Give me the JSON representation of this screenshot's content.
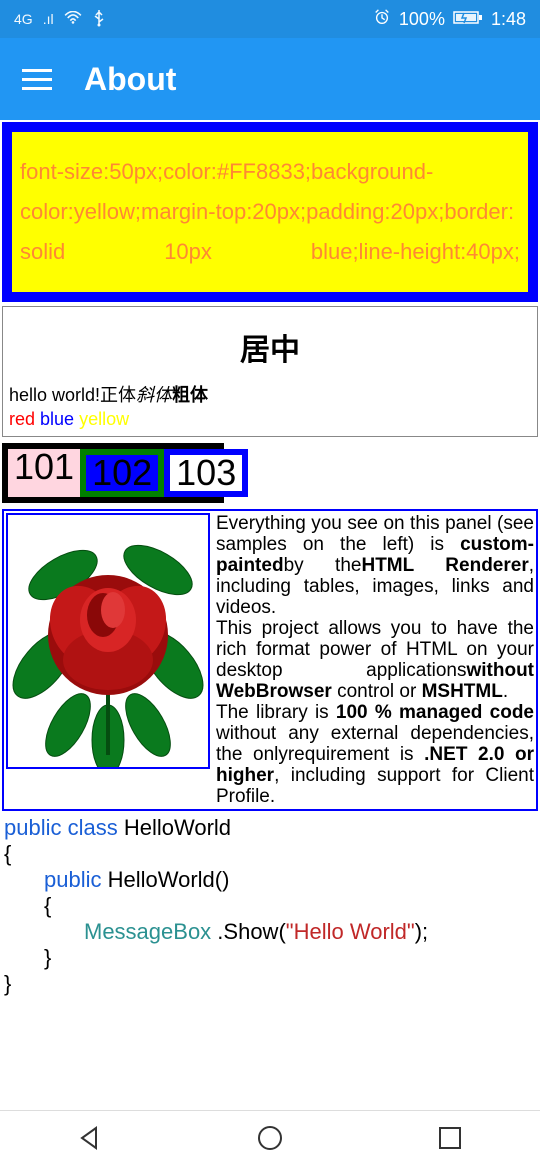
{
  "statusbar": {
    "signal": "4G",
    "battery_pct": "100%",
    "time": "1:48"
  },
  "appbar": {
    "title": "About"
  },
  "yellowbox_text": "font-size:50px;color:#FF8833;background-color:yellow;margin-top:20px;padding:20px;border: solid 10px blue;line-height:40px;",
  "graybox": {
    "centered": "居中",
    "hello_plain": "hello world!正体",
    "hello_italic": "斜体",
    "hello_bold": "粗体",
    "red": "red",
    "blue": "blue",
    "yellow": "yellow"
  },
  "numbers": {
    "a": "101",
    "b": "102",
    "c": "103"
  },
  "panel": {
    "p1a": "Everything you see on this panel (see samples on the left) is",
    "p1b": "custom-painted",
    "p1c": "by the",
    "p1d": "HTML Renderer",
    "p1e": ", including tables, images, links and videos.",
    "p2a": "This project allows you to have the rich format power of HTML on your desktop applications",
    "p2b": "without WebBrowser",
    "p2c": " control or ",
    "p2d": "MSHTML",
    "p2e": ".",
    "p3a": "The library is ",
    "p3b": "100 % managed code",
    "p3c": " without any external dependencies, the only",
    "p3d": "requirement is ",
    "p3e": ".NET 2.0 or higher",
    "p3f": ", including support for Client Profile."
  },
  "code": {
    "l1a": "public class",
    "l1b": " HelloWorld",
    "l2": "{",
    "l3a": "public",
    "l3b": " HelloWorld()",
    "l4": "{",
    "l5a": "MessageBox",
    "l5b": " .Show(",
    "l5c": "\"Hello World\"",
    "l5d": ");",
    "l6": "}",
    "l7": "}"
  }
}
